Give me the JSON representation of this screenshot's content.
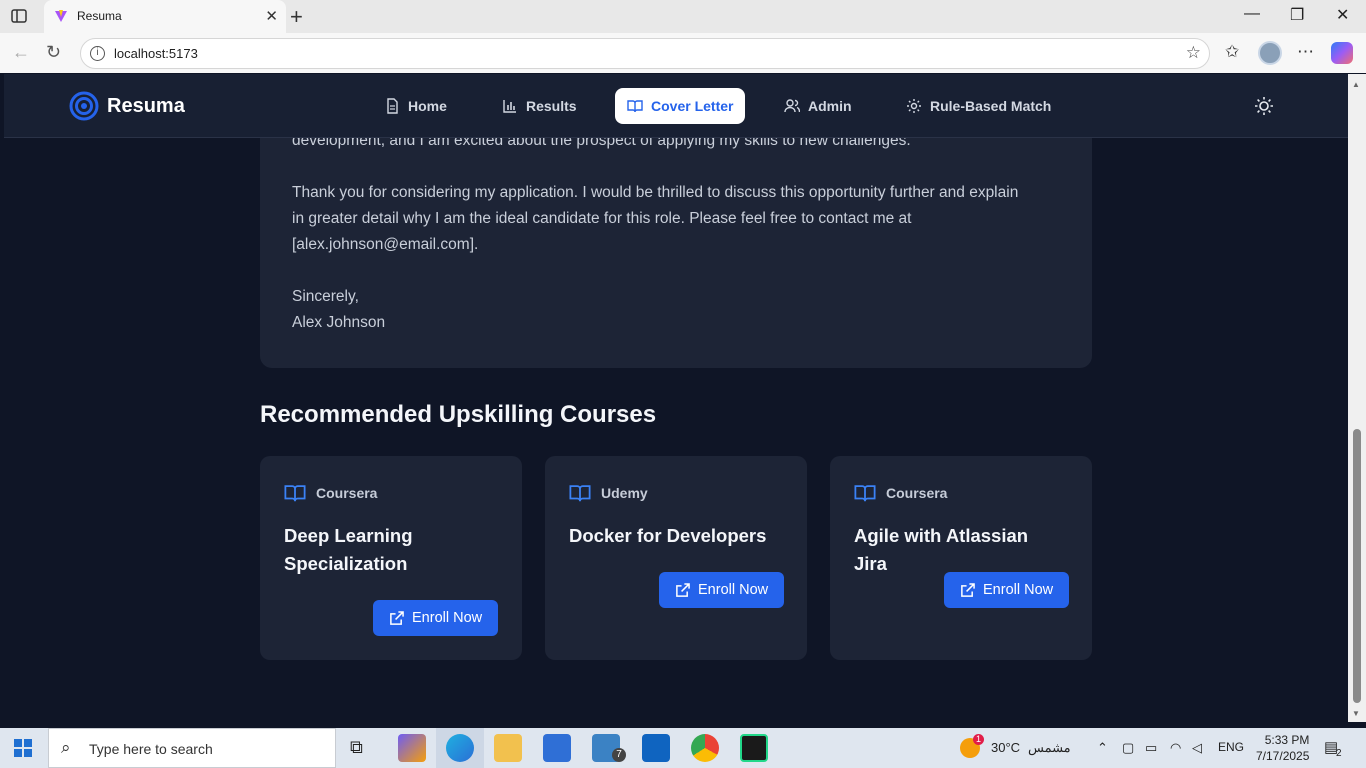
{
  "browser": {
    "tab_title": "Resuma",
    "url": "localhost:5173"
  },
  "app": {
    "brand": "Resuma",
    "nav": [
      {
        "label": "Home",
        "icon": "document-icon"
      },
      {
        "label": "Results",
        "icon": "bar-chart-icon"
      },
      {
        "label": "Cover Letter",
        "icon": "book-open-icon",
        "active": true
      },
      {
        "label": "Admin",
        "icon": "users-icon"
      },
      {
        "label": "Rule-Based Match",
        "icon": "gear-icon"
      }
    ],
    "theme_toggle_icon": "sun-icon"
  },
  "letter": {
    "para_partial": "development, and I am excited about the prospect of applying my skills to new challenges.",
    "para_thanks_1": "Thank you for considering my application. I would be thrilled to discuss this opportunity further and explain",
    "para_thanks_2": "in greater detail why I am the ideal candidate for this role. Please feel free to contact me at",
    "para_thanks_3": "[alex.johnson@email.com].",
    "closing": "Sincerely,",
    "signature": "Alex Johnson"
  },
  "courses_section": {
    "title": "Recommended Upskilling Courses",
    "courses": [
      {
        "provider": "Coursera",
        "title": "Deep Learning Specialization",
        "button": "Enroll Now"
      },
      {
        "provider": "Udemy",
        "title": "Docker for Developers",
        "button": "Enroll Now"
      },
      {
        "provider": "Coursera",
        "title": "Agile with Atlassian Jira",
        "button": "Enroll Now"
      }
    ]
  },
  "taskbar": {
    "search_placeholder": "Type here to search",
    "weather_temp": "30°C",
    "weather_text": "مشمس",
    "weather_badge": "1",
    "language": "ENG",
    "time": "5:33 PM",
    "date": "7/17/2025",
    "notifications": "2",
    "mail_badge": "7"
  },
  "colors": {
    "accent": "#2563eb",
    "page_bg": "#0f1526",
    "card_bg": "#1d2436"
  }
}
